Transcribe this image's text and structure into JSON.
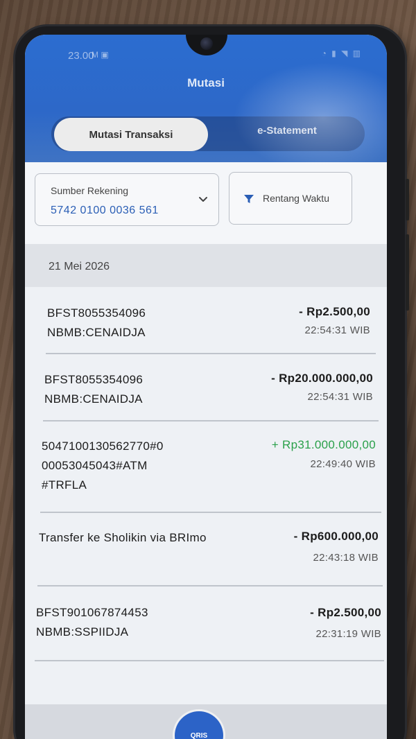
{
  "status_bar": {
    "time": "23.00",
    "icons": "M ▣"
  },
  "header": {
    "title": "Mutasi"
  },
  "tabs": [
    {
      "label": "Mutasi Transaksi",
      "active": true
    },
    {
      "label": "e-Statement",
      "active": false
    }
  ],
  "filters": {
    "source_label": "Sumber Rekening",
    "source_value": "5742 0100 0036 561",
    "date_range_label": "Rentang Waktu"
  },
  "date_header": "21 Mei 2026",
  "transactions": [
    {
      "desc": "BFST8055354096\nNBMB:CENAIDJA",
      "amount": "- Rp2.500,00",
      "time": "22:54:31 WIB",
      "type": "debit"
    },
    {
      "desc": "BFST8055354096\nNBMB:CENAIDJA",
      "amount": "- Rp20.000.000,00",
      "time": "22:54:31 WIB",
      "type": "debit"
    },
    {
      "desc": "5047100130562770#0\n00053045043#ATM\n#TRFLA",
      "amount": "+ Rp31.000.000,00",
      "time": "22:49:40 WIB",
      "type": "credit"
    },
    {
      "desc": "Transfer ke Sholikin via BRImo",
      "amount": "- Rp600.000,00",
      "time": "22:43:18 WIB",
      "type": "debit"
    },
    {
      "desc": "BFST901067874453\nNBMB:SSPIIDJA",
      "amount": "- Rp2.500,00",
      "time": "22:31:19 WIB",
      "type": "debit"
    }
  ],
  "bottom": {
    "qris_label": "QRIS"
  },
  "colors": {
    "primary": "#2c6dd0",
    "credit": "#2aa04a",
    "debit": "#1c1c1c"
  }
}
